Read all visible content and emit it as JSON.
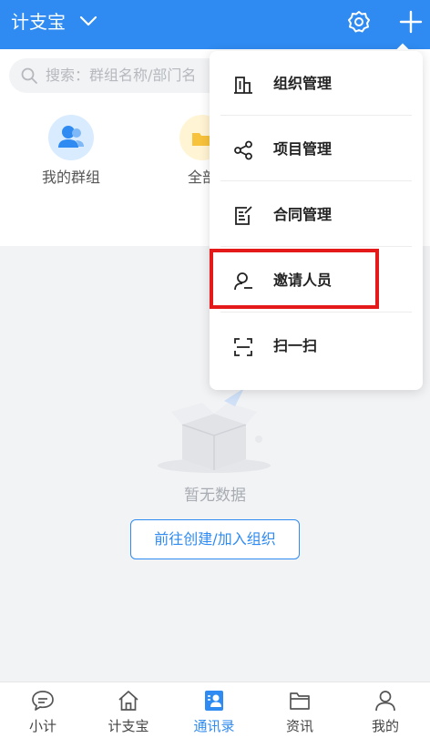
{
  "header": {
    "title": "计支宝",
    "background": "#2f8bf1"
  },
  "search": {
    "placeholder": "搜索：群组名称/部门名"
  },
  "quick_actions": [
    {
      "label": "我的群组",
      "icon": "people-icon"
    },
    {
      "label": "全部",
      "icon": "folder-icon"
    }
  ],
  "empty_state": {
    "text": "暂无数据",
    "button": "前往创建/加入组织"
  },
  "menu": {
    "items": [
      {
        "label": "组织管理",
        "icon": "building-icon"
      },
      {
        "label": "项目管理",
        "icon": "share-icon"
      },
      {
        "label": "合同管理",
        "icon": "contract-icon"
      },
      {
        "label": "邀请人员",
        "icon": "invite-user-icon",
        "highlighted": true
      },
      {
        "label": "扫一扫",
        "icon": "scan-icon"
      }
    ],
    "highlight_color": "#e41a1a"
  },
  "bottom_nav": {
    "items": [
      {
        "label": "小计",
        "icon": "chat-icon"
      },
      {
        "label": "计支宝",
        "icon": "home-icon"
      },
      {
        "label": "通讯录",
        "icon": "contacts-icon",
        "active": true
      },
      {
        "label": "资讯",
        "icon": "news-icon"
      },
      {
        "label": "我的",
        "icon": "profile-icon"
      }
    ],
    "active_color": "#2f8bf1"
  }
}
